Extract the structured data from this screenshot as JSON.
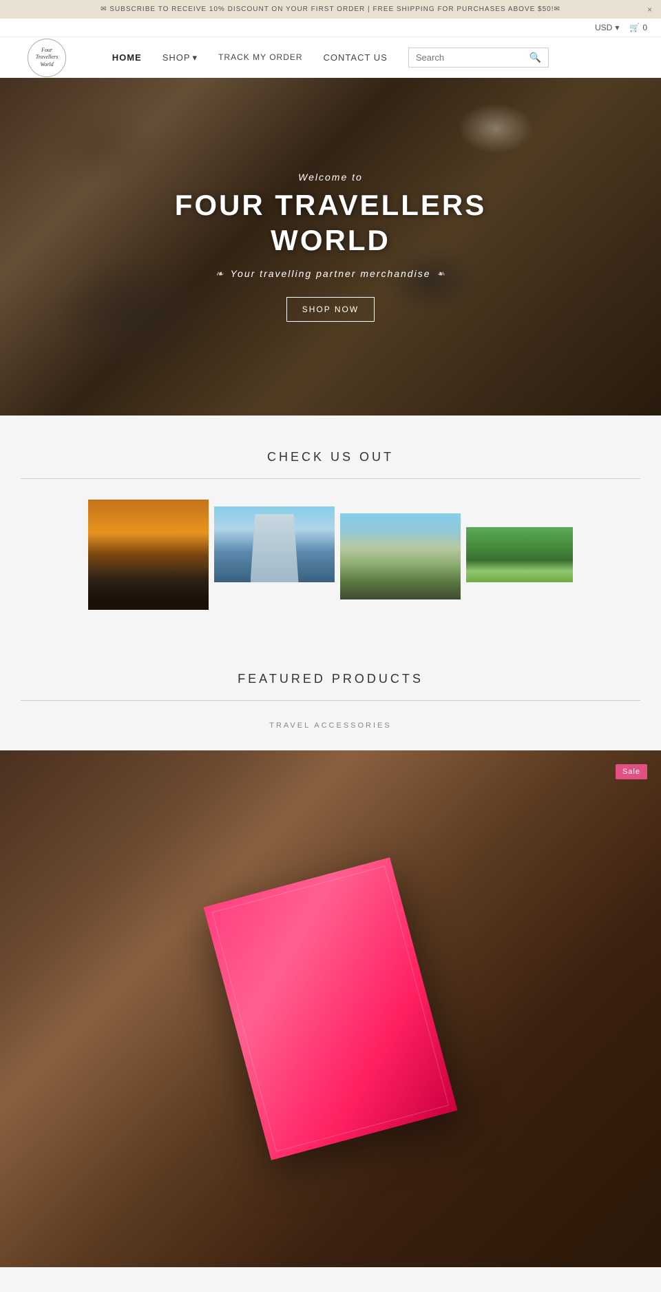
{
  "announcement": {
    "text": "✉ SUBSCRIBE TO RECEIVE 10% DISCOUNT ON YOUR FIRST ORDER  |  FREE SHIPPING FOR PURCHASES ABOVE $50!✉",
    "close_label": "×"
  },
  "utility": {
    "currency_label": "USD",
    "currency_arrow": "▾",
    "cart_icon": "🛒",
    "cart_count": "0"
  },
  "logo": {
    "line1": "Four",
    "line2": "Travellers",
    "line3": "World"
  },
  "nav": {
    "home_label": "HOME",
    "shop_label": "SHOP",
    "shop_arrow": "▾",
    "track_label": "TRACK MY ORDER",
    "contact_label": "CONTACT US",
    "search_placeholder": "Search",
    "search_button_label": "🔍"
  },
  "hero": {
    "welcome_text": "Welcome to",
    "title_line1": "FOUR TRAVELLERS",
    "title_line2": "WORLD",
    "subtitle": "Your travelling partner merchandise",
    "cta_label": "SHOP NOW"
  },
  "check_us_out": {
    "title": "CHECK US OUT",
    "images": [
      {
        "alt": "sunset landscape",
        "style": "sunset"
      },
      {
        "alt": "tall building looking up",
        "style": "building"
      },
      {
        "alt": "Vietnam street scene",
        "style": "vietnam"
      },
      {
        "alt": "temple in garden",
        "style": "temple"
      }
    ]
  },
  "featured_products": {
    "title": "FEATURED PRODUCTS",
    "category_label": "TRAVEL ACCESSORIES",
    "sale_badge": "Sale"
  }
}
